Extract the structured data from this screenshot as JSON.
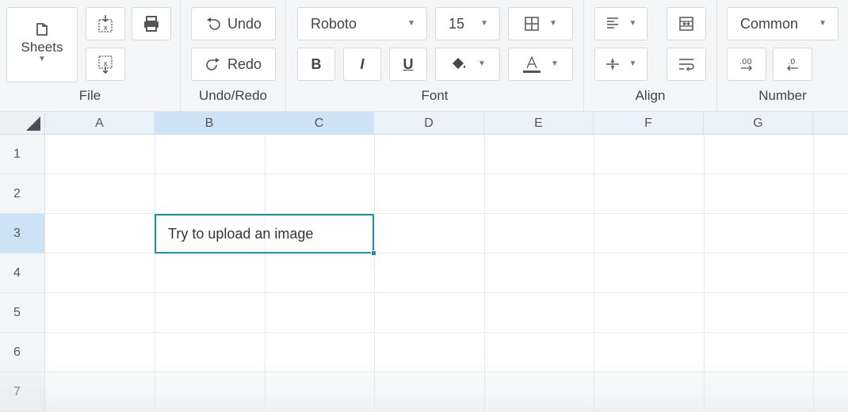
{
  "toolbar": {
    "file": {
      "label": "File",
      "sheets_label": "Sheets",
      "sheets_icon": "sheets-icon",
      "import_icon": "import-excel-icon",
      "export_icon": "export-excel-icon",
      "print_icon": "printer-icon"
    },
    "undo_redo": {
      "label": "Undo/Redo",
      "undo_label": "Undo",
      "redo_label": "Redo"
    },
    "font": {
      "label": "Font",
      "family": "Roboto",
      "size": "15",
      "bold": "B",
      "italic": "I",
      "underline": "U"
    },
    "align": {
      "label": "Align"
    },
    "number": {
      "label": "Number",
      "format": "Common"
    }
  },
  "grid": {
    "columns": [
      "A",
      "B",
      "C",
      "D",
      "E",
      "F",
      "G"
    ],
    "rows": [
      "1",
      "2",
      "3",
      "4",
      "5",
      "6",
      "7"
    ],
    "active_columns": [
      "B",
      "C"
    ],
    "active_row": "3",
    "selected_cell_text": "Try to upload an image"
  },
  "colors": {
    "accent": "#1a93a8",
    "header_active": "#cde2f4",
    "header": "#eaf3fb"
  }
}
